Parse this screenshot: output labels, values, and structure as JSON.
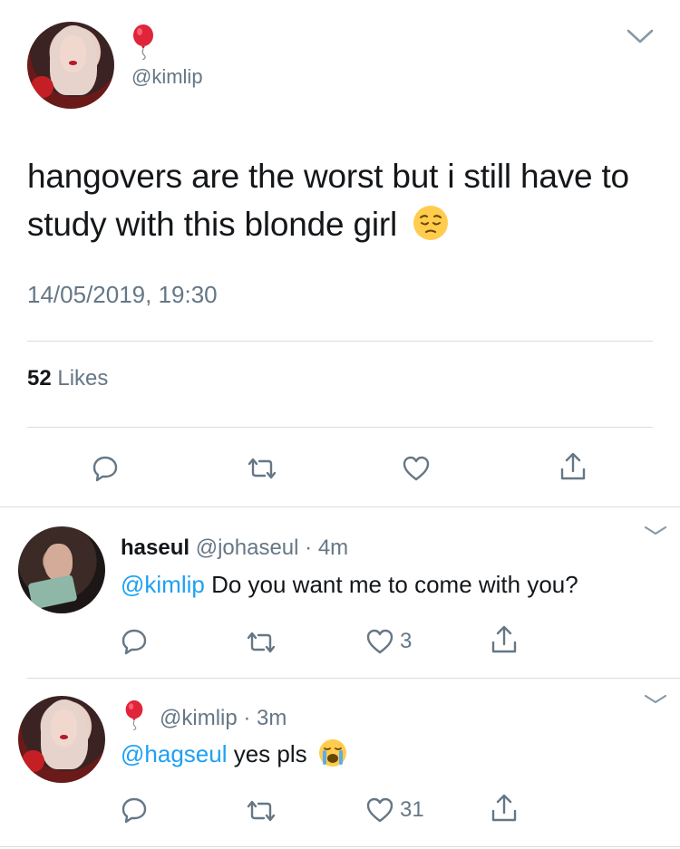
{
  "main_tweet": {
    "handle": "@kimlip",
    "text": "hangovers are the worst but i still have to study with this blonde girl",
    "timestamp": "14/05/2019, 19:30",
    "likes_count": "52",
    "likes_label": "Likes"
  },
  "replies": [
    {
      "display_name": "haseul",
      "handle": "@johaseul",
      "separator": "·",
      "time": "4m",
      "mention": "@kimlip",
      "text": "Do you want me to come with you?",
      "like_count": "3"
    },
    {
      "handle": "@kimlip",
      "separator": "·",
      "time": "3m",
      "mention": "@hagseul",
      "text": "yes pls",
      "like_count": "31"
    }
  ],
  "colors": {
    "link": "#1da1f2",
    "secondary_text": "#657786",
    "icon": "#657786",
    "divider": "#d8dde1"
  },
  "icons": [
    "balloon-icon",
    "chevron-down-icon",
    "reply-icon",
    "retweet-icon",
    "like-icon",
    "share-icon",
    "pensive-face-emoji",
    "crying-face-emoji"
  ]
}
